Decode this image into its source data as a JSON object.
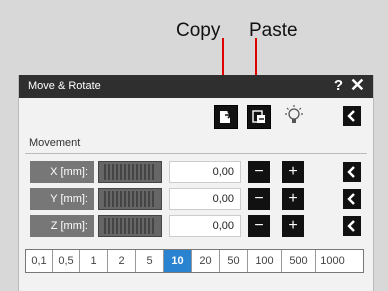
{
  "annotations": {
    "copy": "Copy",
    "paste": "Paste"
  },
  "window": {
    "title": "Move & Rotate",
    "help": "?",
    "close": "✕"
  },
  "toolbar": {
    "copy_icon": "copy-icon",
    "paste_icon": "paste-icon",
    "bulb_icon": "lightbulb-icon",
    "collapse_icon": "chevron-left-icon"
  },
  "movement": {
    "section_label": "Movement",
    "axes": [
      {
        "label": "X [mm]:",
        "value": "0,00"
      },
      {
        "label": "Y [mm]:",
        "value": "0,00"
      },
      {
        "label": "Z [mm]:",
        "value": "0,00"
      }
    ],
    "minus_label": "−",
    "plus_label": "+"
  },
  "step_sizes": {
    "options": [
      "0,1",
      "0,5",
      "1",
      "2",
      "5",
      "10",
      "20",
      "50",
      "100",
      "500",
      "1000"
    ],
    "selected": "10"
  },
  "colors": {
    "accent": "#2a83d1",
    "arrow": "#e00000",
    "titlebar": "#2f2f2f"
  }
}
